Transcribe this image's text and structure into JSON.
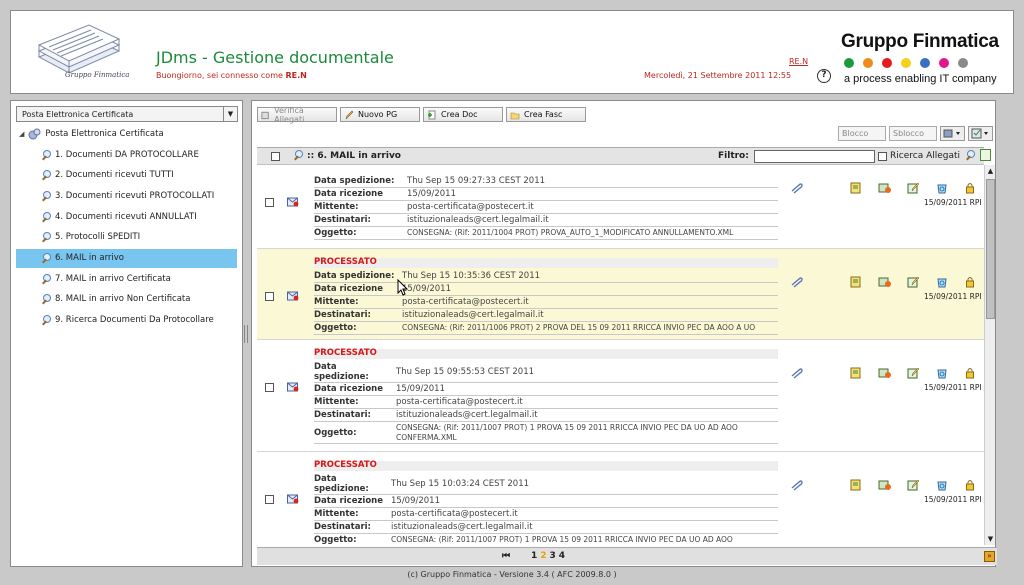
{
  "header": {
    "logo_caption": "Gruppo Finmatica",
    "app_title": "JDms - Gestione documentale",
    "greeting_prefix": "Buongiorno, sei connesso come ",
    "greeting_user": "RE.N",
    "user_link": "RE.N",
    "datetime": "Mercoledì, 21 Settembre 2011 12:55",
    "help_label": "?",
    "brand_name": "Gruppo Finmatica",
    "brand_tagline": "a process enabling IT company",
    "brand_dot_colors": [
      "#1c9a3c",
      "#f08a1c",
      "#e41c1c",
      "#f2d21a",
      "#3b6fc4",
      "#e0188a",
      "#8a8a8a"
    ]
  },
  "sidebar": {
    "select_value": "Posta Elettronica Certificata",
    "root_label": "Posta Elettronica Certificata",
    "items": [
      {
        "label": "1. Documenti DA PROTOCOLLARE",
        "active": false
      },
      {
        "label": "2. Documenti ricevuti TUTTI",
        "active": false
      },
      {
        "label": "3. Documenti ricevuti PROTOCOLLATI",
        "active": false
      },
      {
        "label": "4. Documenti ricevuti ANNULLATI",
        "active": false
      },
      {
        "label": "5. Protocolli SPEDITI",
        "active": false
      },
      {
        "label": "6. MAIL in arrivo",
        "active": true
      },
      {
        "label": "7. MAIL in arrivo Certificata",
        "active": false
      },
      {
        "label": "8. MAIL in arrivo Non Certificata",
        "active": false
      },
      {
        "label": "9. Ricerca Documenti Da Protocollare",
        "active": false
      }
    ]
  },
  "toolbar": {
    "verifica_allegati": "Verifica Allegati",
    "nuovo_pg": "Nuovo PG",
    "crea_doc": "Crea Doc",
    "crea_fasc": "Crea Fasc",
    "blocco_placeholder": "Blocco",
    "sblocco_placeholder": "Sblocco"
  },
  "list": {
    "title": ":: 6. MAIL in arrivo",
    "filtro_label": "Filtro:",
    "filtro_value": "",
    "ricerca_allegati_label": "Ricerca Allegati"
  },
  "labels": {
    "data_spedizione": "Data spedizione:",
    "data_spedizione_l1": "Data",
    "data_spedizione_l2": "spedizione:",
    "data_ricezione": "Data ricezione",
    "mittente": "Mittente:",
    "destinatari": "Destinatari:",
    "oggetto": "Oggetto:"
  },
  "rows": [
    {
      "status": "",
      "data_spedizione": "Thu Sep 15 09:27:33 CEST 2011",
      "data_ricezione": "15/09/2011",
      "mittente": "posta-certificata@postecert.it",
      "destinatari": "istituzionaleads@cert.legalmail.it",
      "oggetto": "CONSEGNA: (Rif: 2011/1004 PROT) PROVA_AUTO_1_MODIFICATO ANNULLAMENTO.XML",
      "date_tag": "15/09/2011 RPI"
    },
    {
      "status": "PROCESSATO",
      "data_spedizione": "Thu Sep 15 10:35:36 CEST 2011",
      "data_ricezione": "15/09/2011",
      "mittente": "posta-certificata@postecert.it",
      "destinatari": "istituzionaleads@cert.legalmail.it",
      "oggetto": "CONSEGNA: (Rif: 2011/1006 PROT) 2 PROVA DEL 15 09 2011 RRICCA INVIO PEC DA AOO A UO",
      "date_tag": "15/09/2011 RPI"
    },
    {
      "status": "PROCESSATO",
      "data_spedizione": "Thu Sep 15 09:55:53 CEST 2011",
      "data_ricezione": "15/09/2011",
      "mittente": "posta-certificata@postecert.it",
      "destinatari": "istituzionaleads@cert.legalmail.it",
      "oggetto_l1": "CONSEGNA: (Rif: 2011/1007 PROT) 1 PROVA 15 09 2011 RRICCA INVIO PEC DA UO AD AOO",
      "oggetto_l2": "CONFERMA.XML",
      "date_tag": "15/09/2011 RPI"
    },
    {
      "status": "PROCESSATO",
      "data_spedizione": "Thu Sep 15 10:03:24 CEST 2011",
      "data_ricezione": "15/09/2011",
      "mittente": "posta-certificata@postecert.it",
      "destinatari": "istituzionaleads@cert.legalmail.it",
      "oggetto": "CONSEGNA: (Rif: 2011/1007 PROT) 1 PROVA 15 09 2011 RRICCA INVIO PEC DA UO AD AOO",
      "date_tag": "15/09/2011 RPI"
    }
  ],
  "pager": {
    "first_symbol": "⏮",
    "pages": [
      "1",
      "2",
      "3",
      "4"
    ],
    "current_page": "2"
  },
  "footer": "(c) Gruppo Finmatica - Versione 3.4  ( AFC 2009.8.0 )"
}
